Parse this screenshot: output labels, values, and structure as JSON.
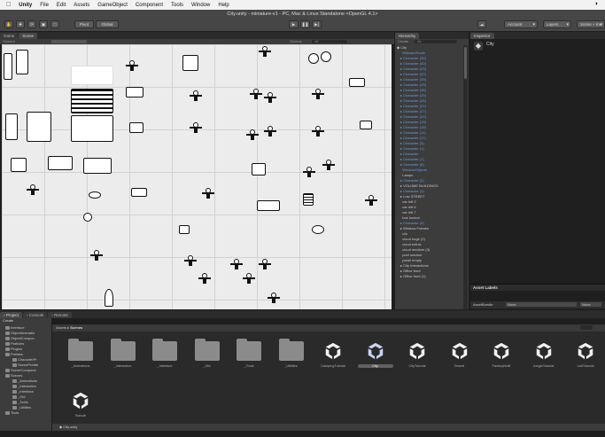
{
  "menubar": {
    "app": "Unity",
    "items": [
      "File",
      "Edit",
      "Assets",
      "GameObject",
      "Component",
      "Tools",
      "Window",
      "Help"
    ]
  },
  "window_title": "City.unity - miniature-v1 - PC, Mac & Linux Standalone <OpenGL 4.1>",
  "toolbar": {
    "pivot": "Pivot",
    "global": "Global",
    "account": "Account",
    "layers": "Layers",
    "layout": "Scene + Ins"
  },
  "scene": {
    "tabs": [
      "Game",
      "Scene"
    ],
    "shaded": "Shaded",
    "gizmos": "Gizmos",
    "search": "All"
  },
  "hierarchy": {
    "tab": "Hierarchy",
    "create": "Create",
    "search": "All",
    "root": "City",
    "rows": [
      {
        "t": "BillboardScale",
        "c": "blue",
        "a": false
      },
      {
        "t": "Character (30)",
        "c": "blue",
        "a": true
      },
      {
        "t": "Character (40)",
        "c": "blue",
        "a": true
      },
      {
        "t": "Character (23)",
        "c": "blue",
        "a": true
      },
      {
        "t": "Character (22)",
        "c": "blue",
        "a": true
      },
      {
        "t": "Character (39)",
        "c": "blue",
        "a": true
      },
      {
        "t": "Character (29)",
        "c": "blue",
        "a": true
      },
      {
        "t": "Character (36)",
        "c": "blue",
        "a": true
      },
      {
        "t": "Character (25)",
        "c": "blue",
        "a": true
      },
      {
        "t": "Character (26)",
        "c": "blue",
        "a": true
      },
      {
        "t": "Character (21)",
        "c": "blue",
        "a": true
      },
      {
        "t": "Character (27)",
        "c": "blue",
        "a": true
      },
      {
        "t": "Character (20)",
        "c": "blue",
        "a": true
      },
      {
        "t": "Character (19)",
        "c": "blue",
        "a": true
      },
      {
        "t": "Character (18)",
        "c": "blue",
        "a": true
      },
      {
        "t": "Character (11)",
        "c": "blue",
        "a": true
      },
      {
        "t": "Character (17)",
        "c": "blue",
        "a": true
      },
      {
        "t": "Character (3)",
        "c": "blue",
        "a": true
      },
      {
        "t": "Character (1)",
        "c": "blue",
        "a": true
      },
      {
        "t": "Character",
        "c": "blue",
        "a": true
      },
      {
        "t": "Character (7)",
        "c": "blue",
        "a": true
      },
      {
        "t": "Character (8)",
        "c": "blue",
        "a": true
      },
      {
        "t": "WindowObjects",
        "c": "blue",
        "a": false
      },
      {
        "t": "Lamps",
        "c": "white",
        "a": false
      },
      {
        "t": "Character (2)",
        "c": "blue",
        "a": true
      },
      {
        "t": "VOLUME BUILDINGS",
        "c": "white",
        "a": true
      },
      {
        "t": "Character (2)",
        "c": "blue",
        "a": true
      },
      {
        "t": "Low STREET",
        "c": "white",
        "a": true
      },
      {
        "t": "car left 2",
        "c": "white",
        "a": false
      },
      {
        "t": "car left 6",
        "c": "white",
        "a": false
      },
      {
        "t": "car left 7",
        "c": "white",
        "a": false
      },
      {
        "t": "bus london",
        "c": "white",
        "a": false
      },
      {
        "t": "Character (5)",
        "c": "blue",
        "a": true
      },
      {
        "t": "Window Frames",
        "c": "white",
        "a": true
      },
      {
        "t": "ufo",
        "c": "white",
        "a": false
      },
      {
        "t": "cloud huge (2)",
        "c": "white",
        "a": false
      },
      {
        "t": "cloud extra1",
        "c": "white",
        "a": false
      },
      {
        "t": "cloud medium (3)",
        "c": "white",
        "a": false
      },
      {
        "t": "pool outdoor",
        "c": "white",
        "a": false
      },
      {
        "t": "panel empty",
        "c": "white",
        "a": false
      },
      {
        "t": "City Interactions",
        "c": "white",
        "a": true
      },
      {
        "t": "Office front",
        "c": "white",
        "a": true
      },
      {
        "t": "Office front (1)",
        "c": "white",
        "a": true
      }
    ]
  },
  "inspector": {
    "tab": "Inspector",
    "object": "City",
    "asset_labels": "Asset Labels",
    "asset_bundle": "AssetBundle",
    "bundle_value": "None",
    "variant_value": "None"
  },
  "project": {
    "tabs": [
      "Project",
      "Console",
      "Remote"
    ],
    "create": "Create",
    "tree": [
      {
        "t": "Interface",
        "d": 1
      },
      {
        "t": "ObjectAnimatio",
        "d": 1
      },
      {
        "t": "ObjectCompon",
        "d": 1
      },
      {
        "t": "Particles",
        "d": 1
      },
      {
        "t": "Plugins",
        "d": 1
      },
      {
        "t": "Prefabs",
        "d": 1
      },
      {
        "t": "CharacterPr",
        "d": 2
      },
      {
        "t": "ScenePrefab",
        "d": 2
      },
      {
        "t": "SceneCompone",
        "d": 1
      },
      {
        "t": "Scenes",
        "d": 1
      },
      {
        "t": "_Animations",
        "d": 2
      },
      {
        "t": "_Interaction",
        "d": 2
      },
      {
        "t": "_Interface",
        "d": 2
      },
      {
        "t": "_Old",
        "d": 2
      },
      {
        "t": "_Tools",
        "d": 2
      },
      {
        "t": "_Utilities",
        "d": 2
      },
      {
        "t": "Tools",
        "d": 1
      }
    ],
    "breadcrumb": [
      "Assets",
      "Scenes"
    ],
    "assets": [
      {
        "name": "_Animations",
        "kind": "folder"
      },
      {
        "name": "_Interaction",
        "kind": "folder"
      },
      {
        "name": "_Interface",
        "kind": "folder"
      },
      {
        "name": "_Old",
        "kind": "folder"
      },
      {
        "name": "_Tools",
        "kind": "folder"
      },
      {
        "name": "_Utilities",
        "kind": "folder"
      },
      {
        "name": "CampingTutorial",
        "kind": "scene"
      },
      {
        "name": "City",
        "kind": "scene",
        "selected": true
      },
      {
        "name": "CityTutorial",
        "kind": "scene"
      },
      {
        "name": "Desert",
        "kind": "scene"
      },
      {
        "name": "FactoryMulti",
        "kind": "scene"
      },
      {
        "name": "JungleTutorial",
        "kind": "scene"
      },
      {
        "name": "LabTutorial",
        "kind": "scene"
      },
      {
        "name": "Suburb",
        "kind": "scene"
      }
    ],
    "status_file": "City.unity"
  }
}
